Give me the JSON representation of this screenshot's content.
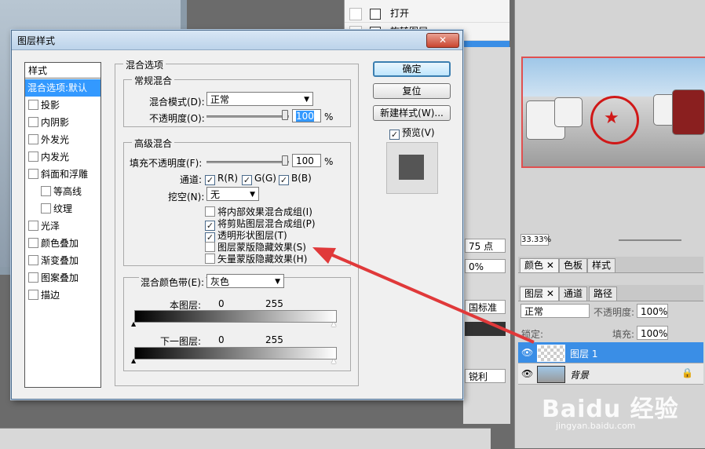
{
  "history": {
    "items": [
      {
        "label": "打开"
      },
      {
        "label": "旋转图层"
      }
    ]
  },
  "navigator": {
    "zoom": "33.33%"
  },
  "panels": {
    "color_tabs": [
      "颜色",
      "色板",
      "样式"
    ],
    "layer_tabs": [
      "图层",
      "通道",
      "路径"
    ],
    "blend_mode": "正常",
    "opacity_label": "不透明度:",
    "opacity": "100%",
    "lock_label": "锁定:",
    "fill_label": "填充:",
    "fill": "100%",
    "layers": [
      {
        "name": "图层 1",
        "selected": true
      },
      {
        "name": "背景",
        "selected": false
      }
    ],
    "partial_labels": {
      "pt": "75 点",
      "pct": "0%",
      "std": "国标准",
      "sharp": "锐利"
    }
  },
  "dialog": {
    "title": "图层样式",
    "close": "✕",
    "style_list": {
      "header": "样式",
      "items": [
        {
          "label": "混合选项:默认",
          "selected": true,
          "checkbox": false,
          "indent": false
        },
        {
          "label": "投影",
          "checkbox": true,
          "indent": false
        },
        {
          "label": "内阴影",
          "checkbox": true,
          "indent": false
        },
        {
          "label": "外发光",
          "checkbox": true,
          "indent": false
        },
        {
          "label": "内发光",
          "checkbox": true,
          "indent": false
        },
        {
          "label": "斜面和浮雕",
          "checkbox": true,
          "indent": false
        },
        {
          "label": "等高线",
          "checkbox": true,
          "indent": true
        },
        {
          "label": "纹理",
          "checkbox": true,
          "indent": true
        },
        {
          "label": "光泽",
          "checkbox": true,
          "indent": false
        },
        {
          "label": "颜色叠加",
          "checkbox": true,
          "indent": false
        },
        {
          "label": "渐变叠加",
          "checkbox": true,
          "indent": false
        },
        {
          "label": "图案叠加",
          "checkbox": true,
          "indent": false
        },
        {
          "label": "描边",
          "checkbox": true,
          "indent": false
        }
      ]
    },
    "blend_options": {
      "legend": "混合选项",
      "general": {
        "legend": "常规混合",
        "mode_label": "混合模式(D):",
        "mode_value": "正常",
        "opacity_label": "不透明度(O):",
        "opacity_value": "100",
        "opacity_unit": "%"
      },
      "advanced": {
        "legend": "高级混合",
        "fill_label": "填充不透明度(F):",
        "fill_value": "100",
        "fill_unit": "%",
        "channels_label": "通道:",
        "channels": [
          {
            "label": "R(R)",
            "checked": true
          },
          {
            "label": "G(G)",
            "checked": true
          },
          {
            "label": "B(B)",
            "checked": true
          }
        ],
        "knockout_label": "挖空(N):",
        "knockout_value": "无",
        "options": [
          {
            "label": "将内部效果混合成组(I)",
            "checked": false
          },
          {
            "label": "将剪贴图层混合成组(P)",
            "checked": true
          },
          {
            "label": "透明形状图层(T)",
            "checked": true
          },
          {
            "label": "图层蒙版隐藏效果(S)",
            "checked": false
          },
          {
            "label": "矢量蒙版隐藏效果(H)",
            "checked": false
          }
        ]
      },
      "blend_if": {
        "label": "混合颜色带(E):",
        "value": "灰色",
        "this_layer_label": "本图层:",
        "this_min": "0",
        "this_max": "255",
        "under_layer_label": "下一图层:",
        "under_min": "0",
        "under_max": "255"
      }
    },
    "buttons": {
      "ok": "确定",
      "reset": "复位",
      "new_style": "新建样式(W)...",
      "preview_label": "预览(V)",
      "preview_checked": true
    }
  },
  "watermark": {
    "brand": "Baidu 经验",
    "url": "jingyan.baidu.com"
  },
  "colors": {
    "selection": "#3399ff",
    "arrow": "#e0393a",
    "stamp": "#d01818"
  }
}
